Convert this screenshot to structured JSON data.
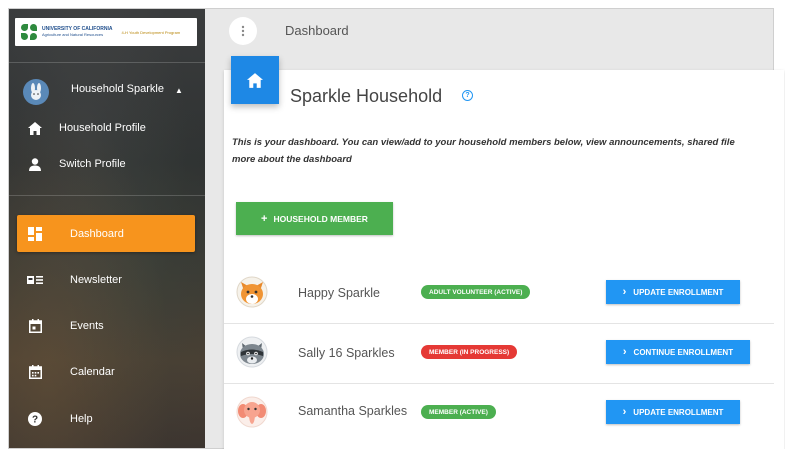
{
  "sidebar": {
    "logo": {
      "university": "UNIVERSITY OF CALIFORNIA",
      "division": "Agriculture and Natural Resources",
      "program": "4-H Youth Development Program"
    },
    "profile": {
      "household_name": "Household Sparkle",
      "caret": "▲"
    },
    "links": [
      {
        "label": "Household Profile",
        "icon": "home-icon"
      },
      {
        "label": "Switch Profile",
        "icon": "person-icon"
      }
    ],
    "nav": [
      {
        "label": "Dashboard",
        "icon": "dashboard-icon",
        "active": true
      },
      {
        "label": "Newsletter",
        "icon": "newsletter-icon",
        "active": false
      },
      {
        "label": "Events",
        "icon": "events-icon",
        "active": false
      },
      {
        "label": "Calendar",
        "icon": "calendar-icon",
        "active": false
      },
      {
        "label": "Help",
        "icon": "help-icon",
        "active": false
      }
    ]
  },
  "topbar": {
    "menu_icon": "kebab-icon",
    "title": "Dashboard"
  },
  "main": {
    "title": "Sparkle Household",
    "intro_line1": "This is your dashboard. You can view/add to your household members below, view announcements, shared file",
    "intro_line2": "more about the dashboard",
    "add_button": {
      "plus": "+",
      "label": "HOUSEHOLD MEMBER"
    },
    "members": [
      {
        "name": "Happy Sparkle",
        "badge": "ADULT VOLUNTEER (ACTIVE)",
        "badge_color": "#4caf50",
        "button": "UPDATE ENROLLMENT",
        "avatar_icon": "fox-avatar-icon"
      },
      {
        "name": "Sally 16 Sparkles",
        "badge": "MEMBER (IN PROGRESS)",
        "badge_color": "#e53935",
        "button": "CONTINUE ENROLLMENT",
        "avatar_icon": "raccoon-avatar-icon"
      },
      {
        "name": "Samantha Sparkles",
        "badge": "MEMBER (ACTIVE)",
        "badge_color": "#4caf50",
        "button": "UPDATE ENROLLMENT",
        "avatar_icon": "elephant-avatar-icon"
      }
    ],
    "chevron": "›"
  },
  "colors": {
    "accent_orange": "#f7941d",
    "primary_blue": "#1e88e5",
    "button_blue": "#2196f3",
    "success_green": "#4caf50",
    "danger_red": "#e53935"
  }
}
